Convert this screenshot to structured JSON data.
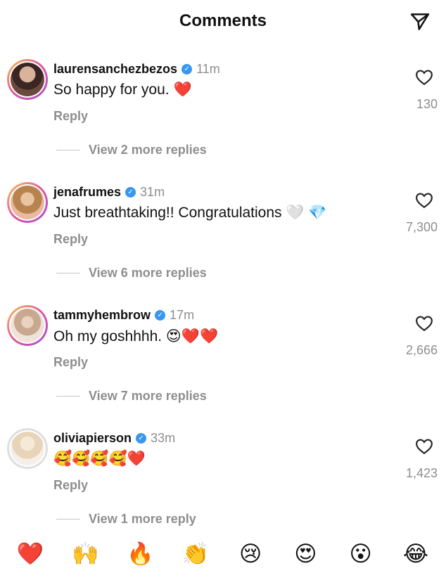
{
  "header": {
    "title": "Comments"
  },
  "comments": [
    {
      "username": "laurensanchezbezos",
      "time": "11m",
      "text": "So happy for you. ❤️",
      "reply_label": "Reply",
      "view_more": "View 2 more replies",
      "likes": "130"
    },
    {
      "username": "jenafrumes",
      "time": "31m",
      "text": "Just breathtaking!! Congratulations 🤍 💎",
      "reply_label": "Reply",
      "view_more": "View 6 more replies",
      "likes": "7,300"
    },
    {
      "username": "tammyhembrow",
      "time": "17m",
      "text": "Oh my goshhhh. 😍❤️❤️",
      "reply_label": "Reply",
      "view_more": "View 7 more replies",
      "likes": "2,666"
    },
    {
      "username": "oliviapierson",
      "time": "33m",
      "text": "🥰🥰🥰🥰❤️",
      "reply_label": "Reply",
      "view_more": "View 1 more reply",
      "likes": "1,423"
    }
  ],
  "reactions": [
    "❤️",
    "🙌",
    "🔥",
    "👏",
    "😢",
    "😍",
    "😮",
    "😂"
  ],
  "icons": {
    "send": "send-icon",
    "like": "heart-outline-icon",
    "verified": "verified-badge-icon"
  },
  "colors": {
    "verified": "#3897f0",
    "secondary_text": "#8e8e8e"
  }
}
